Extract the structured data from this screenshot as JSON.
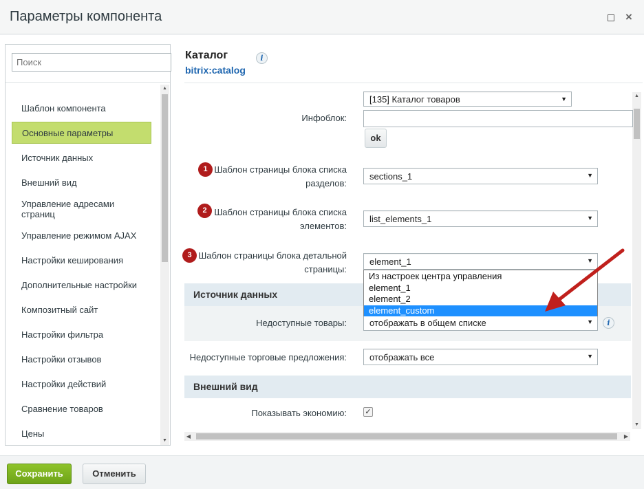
{
  "window": {
    "title": "Параметры компонента",
    "maximize_icon": "maximize-icon",
    "close_icon": "close-icon",
    "close_glyph": "×"
  },
  "sidebar": {
    "search_placeholder": "Поиск",
    "items": [
      {
        "label": "Шаблон компонента"
      },
      {
        "label": "Основные параметры",
        "active": true
      },
      {
        "label": "Источник данных"
      },
      {
        "label": "Внешний вид"
      },
      {
        "label": "Управление адресами страниц"
      },
      {
        "label": "Управление режимом AJAX"
      },
      {
        "label": "Настройки кеширования"
      },
      {
        "label": "Дополнительные настройки"
      },
      {
        "label": "Композитный сайт"
      },
      {
        "label": "Настройки фильтра"
      },
      {
        "label": "Настройки отзывов"
      },
      {
        "label": "Настройки действий"
      },
      {
        "label": "Сравнение товаров"
      },
      {
        "label": "Цены"
      }
    ]
  },
  "main": {
    "title": "Каталог",
    "subtitle": "bitrix:catalog",
    "info_glyph": "i",
    "infoblock": {
      "label": "Инфоблок:",
      "select_value": "[135] Каталог товаров",
      "ok_label": "ok"
    },
    "params": [
      {
        "badge": "1",
        "label_line1": "Шаблон страницы блока списка",
        "label_line2": "разделов:",
        "value": "sections_1"
      },
      {
        "badge": "2",
        "label_line1": "Шаблон страницы блока списка",
        "label_line2": "элементов:",
        "value": "list_elements_1"
      },
      {
        "badge": "3",
        "label_line1": "Шаблон страницы блока детальной",
        "label_line2": "страницы:",
        "value": "element_1"
      }
    ],
    "dropdown_options": [
      "Из настроек центра управления",
      "element_1",
      "element_2",
      "element_custom"
    ],
    "dropdown_selected_index": 3,
    "section_data_source": {
      "title": "Источник данных",
      "unavailable_goods_label": "Недоступные товары:",
      "unavailable_goods_value": "отображать в общем списке"
    },
    "unavailable_offers": {
      "label": "Недоступные торговые предложения:",
      "value": "отображать все"
    },
    "section_view": {
      "title": "Внешний вид",
      "show_savings_label": "Показывать экономию:",
      "show_savings_checked": true
    }
  },
  "footer": {
    "save_label": "Сохранить",
    "cancel_label": "Отменить"
  },
  "colors": {
    "save_button": "#7ab51d",
    "active_nav": "#c3dd6e",
    "badge": "#b01c1c",
    "arrow": "#c0201c",
    "link": "#2067b0",
    "dropdown_highlight": "#1e90ff"
  }
}
